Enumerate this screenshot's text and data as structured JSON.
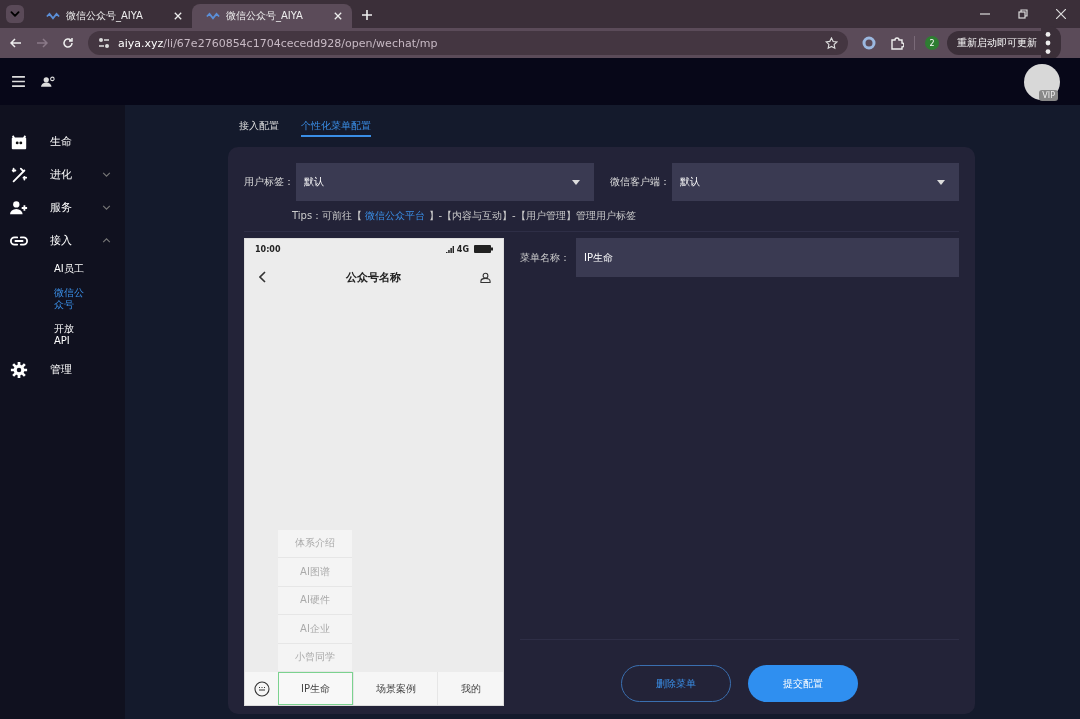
{
  "browser": {
    "tabs": [
      {
        "title": "微信公众号_AIYA",
        "selected": false
      },
      {
        "title": "微信公众号_AIYA",
        "selected": true
      }
    ],
    "url_host": "aiya.xyz",
    "url_path": "/li/67e2760854c1704cecedd928/open/wechat/mp",
    "extension_badge": "2",
    "update_button": "重新启动即可更新"
  },
  "header": {
    "avatar_badge": "VIP"
  },
  "sidebar": {
    "items": [
      {
        "label": "生命",
        "kind": "link"
      },
      {
        "label": "进化",
        "kind": "group",
        "expanded": false
      },
      {
        "label": "服务",
        "kind": "group",
        "expanded": false
      },
      {
        "label": "接入",
        "kind": "group",
        "expanded": true,
        "children": [
          {
            "label": "AI员工",
            "selected": false
          },
          {
            "label": "微信公众号",
            "selected": true
          },
          {
            "label": "开放API",
            "selected": false
          }
        ]
      },
      {
        "label": "管理",
        "kind": "link"
      }
    ]
  },
  "tabs": [
    {
      "label": "接入配置",
      "selected": false
    },
    {
      "label": "个性化菜单配置",
      "selected": true
    }
  ],
  "filters": [
    {
      "label": "用户标签：",
      "value": "默认"
    },
    {
      "label": "微信客户端：",
      "value": "默认"
    }
  ],
  "tips": {
    "prefix": "Tips：可前往【",
    "link": "微信公众平台",
    "suffix": "】-【内容与互动】-【用户管理】管理用户标签"
  },
  "phone": {
    "time": "10:00",
    "network": "4G",
    "title": "公众号名称",
    "submenu": [
      "体系介绍",
      "AI图谱",
      "AI硬件",
      "AI企业",
      "小曾同学"
    ],
    "menu": [
      {
        "label": "IP生命",
        "selected": true
      },
      {
        "label": "场景案例",
        "selected": false
      },
      {
        "label": "我的",
        "selected": false
      }
    ]
  },
  "menu_name": {
    "label": "菜单名称：",
    "value": "IP生命"
  },
  "buttons": [
    {
      "label": "删除菜单",
      "kind": "outline"
    },
    {
      "label": "提交配置",
      "kind": "primary"
    }
  ]
}
